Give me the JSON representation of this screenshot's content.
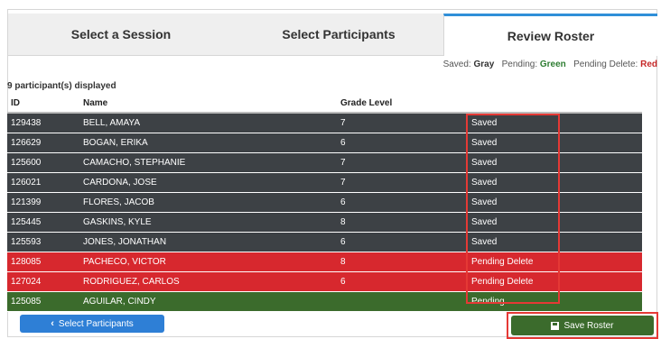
{
  "tabs": [
    {
      "label": "Select a Session"
    },
    {
      "label": "Select Participants"
    },
    {
      "label": "Review Roster"
    }
  ],
  "legend": {
    "saved_label": "Saved:",
    "saved_value": "Gray",
    "pending_label": "Pending:",
    "pending_value": "Green",
    "pending_delete_label": "Pending Delete:",
    "pending_delete_value": "Red"
  },
  "count_text": "9 participant(s) displayed",
  "table": {
    "headers": {
      "id": "ID",
      "name": "Name",
      "grade": "Grade Level",
      "status": ""
    },
    "rows": [
      {
        "id": "129438",
        "name": "BELL, AMAYA",
        "grade": "7",
        "status": "Saved"
      },
      {
        "id": "126629",
        "name": "BOGAN, ERIKA",
        "grade": "6",
        "status": "Saved"
      },
      {
        "id": "125600",
        "name": "CAMACHO, STEPHANIE",
        "grade": "7",
        "status": "Saved"
      },
      {
        "id": "126021",
        "name": "CARDONA, JOSE",
        "grade": "7",
        "status": "Saved"
      },
      {
        "id": "121399",
        "name": "FLORES, JACOB",
        "grade": "6",
        "status": "Saved"
      },
      {
        "id": "125445",
        "name": "GASKINS, KYLE",
        "grade": "8",
        "status": "Saved"
      },
      {
        "id": "125593",
        "name": "JONES, JONATHAN",
        "grade": "6",
        "status": "Saved"
      },
      {
        "id": "128085",
        "name": "PACHECO, VICTOR",
        "grade": "8",
        "status": "Pending Delete"
      },
      {
        "id": "127024",
        "name": "RODRIGUEZ, CARLOS",
        "grade": "6",
        "status": "Pending Delete"
      },
      {
        "id": "125085",
        "name": "AGUILAR, CINDY",
        "grade": "",
        "status": "Pending"
      }
    ]
  },
  "buttons": {
    "back_label": "Select Participants",
    "back_icon": "chevron-left-icon",
    "save_label": "Save Roster",
    "save_icon": "floppy-disk-icon"
  },
  "colors": {
    "saved": "#3d4145",
    "pending": "#3b6b2c",
    "pending_delete": "#d7282e",
    "highlight": "#e53935",
    "primary": "#2e7fd6"
  }
}
